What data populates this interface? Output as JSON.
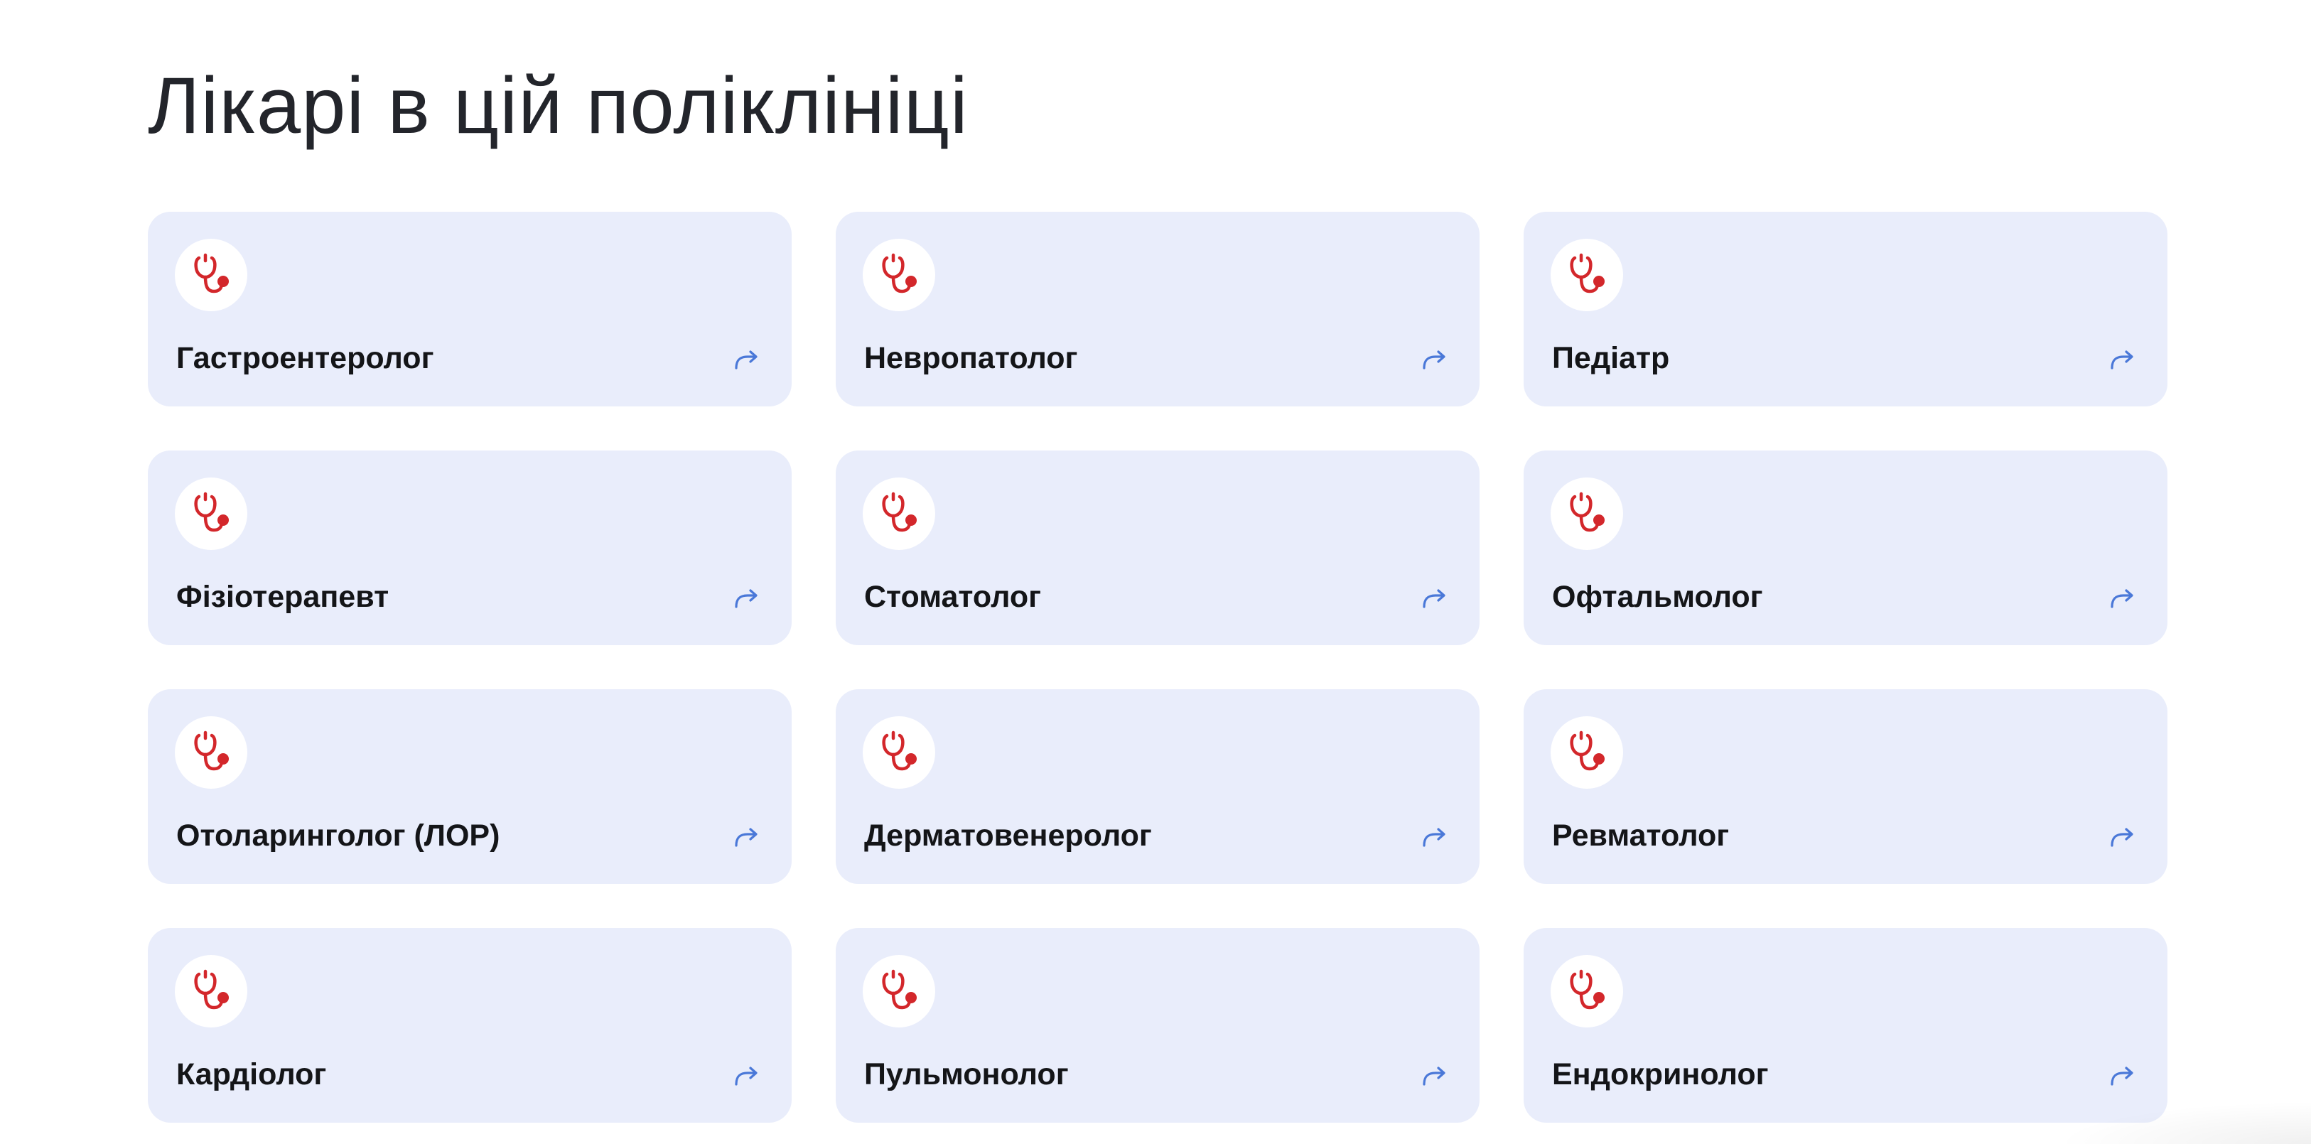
{
  "page": {
    "title": "Лікарі в цій поліклініці"
  },
  "colors": {
    "card_background": "#e9edfb",
    "icon_accent": "#d3272b",
    "arrow_accent": "#4a78d8"
  },
  "icons": {
    "specialty": "stethoscope-icon",
    "link": "share-arrow-icon"
  },
  "doctors": [
    {
      "label": "Гастроентеролог"
    },
    {
      "label": "Невропатолог"
    },
    {
      "label": "Педіатр"
    },
    {
      "label": "Фізіотерапевт"
    },
    {
      "label": "Стоматолог"
    },
    {
      "label": "Офтальмолог"
    },
    {
      "label": "Отоларинголог (ЛОР)"
    },
    {
      "label": "Дерматовенеролог"
    },
    {
      "label": "Ревматолог"
    },
    {
      "label": "Кардіолог"
    },
    {
      "label": "Пульмонолог"
    },
    {
      "label": "Ендокринолог"
    }
  ]
}
